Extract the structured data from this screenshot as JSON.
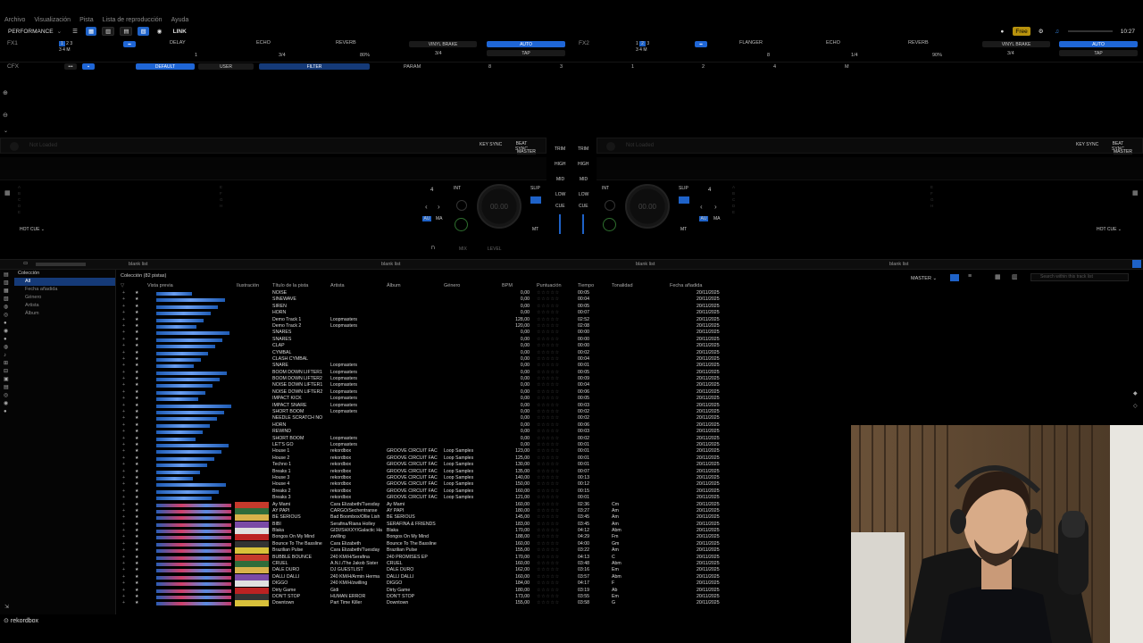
{
  "menu": {
    "items": [
      "Archivo",
      "Visualización",
      "Pista",
      "Lista de reproducción",
      "Ayuda"
    ]
  },
  "toolbar": {
    "mode": "PERFORMANCE",
    "link": "LINK",
    "free": "Free",
    "time": "10:27"
  },
  "fx1": {
    "label": "FX1",
    "slots": [
      {
        "name": "DELAY",
        "value": "1"
      },
      {
        "name": "ECHO",
        "value": "3/4"
      },
      {
        "name": "REVERB",
        "value": "80%"
      }
    ],
    "vinyl_brake": "VINYL BRAKE",
    "vinyl_value": "3/4",
    "auto": "AUTO",
    "tap": "TAP"
  },
  "fx2": {
    "label": "FX2",
    "slots": [
      {
        "name": "FLANGER",
        "value": "8"
      },
      {
        "name": "ECHO",
        "value": "1/4"
      },
      {
        "name": "REVERB",
        "value": "90%"
      }
    ],
    "vinyl_brake": "VINYL BRAKE",
    "vinyl_value": "3/4",
    "auto": "AUTO",
    "tap": "TAP"
  },
  "cfx": {
    "label": "CFX",
    "default": "DEFAULT",
    "user": "USER",
    "filter": "FILTER",
    "param": "PARAM",
    "nums": [
      "8",
      "3",
      "1",
      "2",
      "4",
      "M"
    ]
  },
  "deck1": {
    "name": "Not Loaded",
    "keysync": "KEY SYNC",
    "beatsync": "BEAT SYNC",
    "master": "MASTER",
    "hotcue": "HOT CUE",
    "time": "00.00",
    "beat": "4",
    "int": "INT",
    "slip": "SLIP",
    "au": "AU",
    "ma": "MA",
    "mt": "MT"
  },
  "deck2": {
    "name": "Not Loaded",
    "keysync": "KEY SYNC",
    "beatsync": "BEAT SYNC",
    "master": "MASTER",
    "hotcue": "HOT CUE",
    "time": "00.00",
    "beat": "4",
    "int": "INT",
    "slip": "SLIP",
    "au": "AU",
    "ma": "MA",
    "mt": "MT"
  },
  "mixer": {
    "trim": "TRIM",
    "high": "HIGH",
    "mid": "MID",
    "low": "LOW",
    "cue": "CUE",
    "mix": "MIX",
    "level": "LEVEL"
  },
  "browser": {
    "blank_lists": [
      "blank list",
      "blank list",
      "blank list",
      "blank list"
    ],
    "master": "MASTER",
    "search_placeholder": "Search within this track list",
    "collection_title": "Colección (82 pistas)",
    "tree": [
      "Colección",
      "All",
      "Fecha añadida",
      "Género",
      "Artista",
      "Álbum"
    ],
    "columns": [
      "Vista previa",
      "Ilustración",
      "Título de la pista",
      "Artista",
      "Álbum",
      "Género",
      "BPM",
      "Puntuación",
      "Tiempo",
      "Tonalidad",
      "Fecha añadida"
    ],
    "rows": [
      [
        "NOISE",
        "",
        "",
        "",
        "0,00",
        "00:05",
        "",
        "20/11/2025"
      ],
      [
        "SINEWAVE",
        "",
        "",
        "",
        "0,00",
        "00:04",
        "",
        "20/11/2025"
      ],
      [
        "SIREN",
        "",
        "",
        "",
        "0,00",
        "00:05",
        "",
        "20/11/2025"
      ],
      [
        "HORN",
        "",
        "",
        "",
        "0,00",
        "00:07",
        "",
        "20/11/2025"
      ],
      [
        "Demo Track 1",
        "Loopmasters",
        "",
        "",
        "128,00",
        "02:52",
        "",
        "20/11/2025"
      ],
      [
        "Demo Track 2",
        "Loopmasters",
        "",
        "",
        "120,00",
        "02:08",
        "",
        "20/11/2025"
      ],
      [
        "SNARES",
        "",
        "",
        "",
        "0,00",
        "00:00",
        "",
        "20/11/2025"
      ],
      [
        "SNARES",
        "",
        "",
        "",
        "0,00",
        "00:00",
        "",
        "20/11/2025"
      ],
      [
        "CLAP",
        "",
        "",
        "",
        "0,00",
        "00:00",
        "",
        "20/11/2025"
      ],
      [
        "CYMBAL",
        "",
        "",
        "",
        "0,00",
        "00:02",
        "",
        "20/11/2025"
      ],
      [
        "CLASH CYMBAL",
        "",
        "",
        "",
        "0,00",
        "00:04",
        "",
        "20/11/2025"
      ],
      [
        "SNARE",
        "Loopmasters",
        "",
        "",
        "0,00",
        "00:01",
        "",
        "20/11/2025"
      ],
      [
        "BOOM DOWN LIFTER1",
        "Loopmasters",
        "",
        "",
        "0,00",
        "00:05",
        "",
        "20/11/2025"
      ],
      [
        "BOOM DOWN LIFTER2",
        "Loopmasters",
        "",
        "",
        "0,00",
        "00:09",
        "",
        "20/11/2025"
      ],
      [
        "NOISE DOWN LIFTER1",
        "Loopmasters",
        "",
        "",
        "0,00",
        "00:04",
        "",
        "20/11/2025"
      ],
      [
        "NOISE DOWN LIFTER2",
        "Loopmasters",
        "",
        "",
        "0,00",
        "00:06",
        "",
        "20/11/2025"
      ],
      [
        "IMPACT KICK",
        "Loopmasters",
        "",
        "",
        "0,00",
        "00:05",
        "",
        "20/11/2025"
      ],
      [
        "IMPACT SNARE",
        "Loopmasters",
        "",
        "",
        "0,00",
        "00:03",
        "",
        "20/11/2025"
      ],
      [
        "SHORT BOOM",
        "Loopmasters",
        "",
        "",
        "0,00",
        "00:02",
        "",
        "20/11/2025"
      ],
      [
        "NEEDLE SCRATCH NO",
        "",
        "",
        "",
        "0,00",
        "00:02",
        "",
        "20/11/2025"
      ],
      [
        "HORN",
        "",
        "",
        "",
        "0,00",
        "00:06",
        "",
        "20/11/2025"
      ],
      [
        "REWIND",
        "",
        "",
        "",
        "0,00",
        "00:03",
        "",
        "20/11/2025"
      ],
      [
        "SHORT BOOM",
        "Loopmasters",
        "",
        "",
        "0,00",
        "00:02",
        "",
        "20/11/2025"
      ],
      [
        "LET'S GO",
        "Loopmasters",
        "",
        "",
        "0,00",
        "00:01",
        "",
        "20/11/2025"
      ],
      [
        "House 1",
        "rekordbox",
        "GROOVE CIRCUIT FAC",
        "Loop Samples",
        "123,00",
        "00:01",
        "",
        "20/11/2025"
      ],
      [
        "House 2",
        "rekordbox",
        "GROOVE CIRCUIT FAC",
        "Loop Samples",
        "125,00",
        "00:01",
        "",
        "20/11/2025"
      ],
      [
        "Techno 1",
        "rekordbox",
        "GROOVE CIRCUIT FAC",
        "Loop Samples",
        "130,00",
        "00:01",
        "",
        "20/11/2025"
      ],
      [
        "Breaks 1",
        "rekordbox",
        "GROOVE CIRCUIT FAC",
        "Loop Samples",
        "135,00",
        "00:07",
        "",
        "20/11/2025"
      ],
      [
        "House 3",
        "rekordbox",
        "GROOVE CIRCUIT FAC",
        "Loop Samples",
        "140,00",
        "00:13",
        "",
        "20/11/2025"
      ],
      [
        "House 4",
        "rekordbox",
        "GROOVE CIRCUIT FAC",
        "Loop Samples",
        "150,00",
        "00:12",
        "",
        "20/11/2025"
      ],
      [
        "Breaks 2",
        "rekordbox",
        "GROOVE CIRCUIT FAC",
        "Loop Samples",
        "160,00",
        "00:15",
        "",
        "20/11/2025"
      ],
      [
        "Breaks 3",
        "rekordbox",
        "GROOVE CIRCUIT FAC",
        "Loop Samples",
        "121,00",
        "00:01",
        "",
        "20/11/2025"
      ],
      [
        "Ay Mami",
        "Cara Elizabeth/Tuesday",
        "Ay Mami",
        "",
        "160,00",
        "02:36",
        "Cm",
        "20/11/2025"
      ],
      [
        "AY PAPI",
        "CARGO/Sechentranse",
        "AY PAPI",
        "",
        "180,00",
        "03:27",
        "Am",
        "20/11/2025"
      ],
      [
        "BE SERIOUS",
        "Bad Boombox/Ollie Lish",
        "BE SERIOUS",
        "",
        "145,00",
        "03:45",
        "Am",
        "20/11/2025"
      ],
      [
        "BIBI",
        "Serafina/Riana Holley",
        "SERAFINA & FRIENDS",
        "",
        "183,00",
        "03:45",
        "Am",
        "20/11/2025"
      ],
      [
        "Blaka",
        "GIDI/SHXXY/Galactic Ha",
        "Blaka",
        "",
        "170,00",
        "04:12",
        "Abm",
        "20/11/2025"
      ],
      [
        "Bongos On My Mind",
        "zwilling",
        "Bongos On My Mind",
        "",
        "188,00",
        "04:29",
        "Fm",
        "20/11/2025"
      ],
      [
        "Bounce To The Bassline",
        "Cara Elizabeth",
        "Bounce To The Bassline",
        "",
        "160,00",
        "04:00",
        "Gm",
        "20/11/2025"
      ],
      [
        "Brazilian Pulse",
        "Cara Elizabeth/Tuesday",
        "Brazilian Pulse",
        "",
        "155,00",
        "03:22",
        "Am",
        "20/11/2025"
      ],
      [
        "BUBBLE BOUNCE",
        "240 KM/H/Serafina",
        "240 PROMISES EP",
        "",
        "170,00",
        "04:13",
        "C",
        "20/11/2025"
      ],
      [
        "CRUEL",
        "A.N.I./The Jakob Sister",
        "CRUEL",
        "",
        "160,00",
        "03:48",
        "Abm",
        "20/11/2025"
      ],
      [
        "DALE DURO",
        "DJ GUESTLIST",
        "DALE DURO",
        "",
        "162,00",
        "03:16",
        "Em",
        "20/11/2025"
      ],
      [
        "DALLI DALLI",
        "240 KM/H/Armin Herma",
        "DALLI DALLI",
        "",
        "160,00",
        "03:57",
        "Abm",
        "20/11/2025"
      ],
      [
        "DIGGO",
        "240 KM/H/zwilling",
        "DIGGO",
        "",
        "184,00",
        "04:17",
        "F",
        "20/11/2025"
      ],
      [
        "Dirty Game",
        "Gidi",
        "Dirty Game",
        "",
        "180,00",
        "03:19",
        "Ab",
        "20/11/2025"
      ],
      [
        "DON'T STOP",
        "HUMAN ERROR",
        "DON'T STOP",
        "",
        "173,00",
        "03:55",
        "Em",
        "20/11/2025"
      ],
      [
        "Downtown",
        "Part Time Killer",
        "Downtown",
        "",
        "155,00",
        "03:58",
        "G",
        "20/11/2025"
      ]
    ]
  },
  "footer": {
    "logo": "rekordbox"
  },
  "colors": {
    "accent": "#1e62c8",
    "select": "#153a78"
  }
}
